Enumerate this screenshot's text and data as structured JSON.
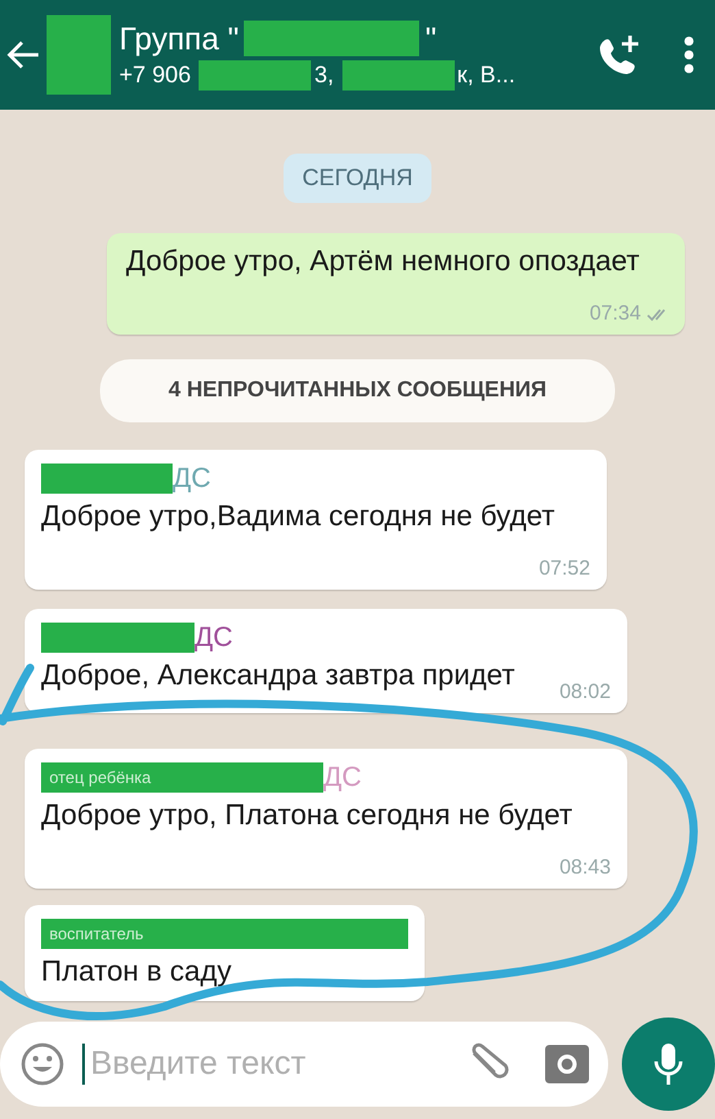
{
  "header": {
    "title": [
      {
        "kind": "text",
        "text": "Группа \""
      },
      {
        "kind": "mask"
      },
      {
        "kind": "text",
        "text": "\""
      }
    ],
    "subtitle": [
      {
        "kind": "text",
        "text": "+7 906"
      },
      {
        "kind": "mask"
      },
      {
        "kind": "text",
        "text": "3,"
      },
      {
        "kind": "mask"
      },
      {
        "kind": "text",
        "text": "к, В..."
      }
    ]
  },
  "messages": [
    {
      "kind": "date",
      "text": "СЕГОДНЯ"
    },
    {
      "kind": "outgoing",
      "text": "Доброе утро, Артём немного опоздает",
      "time": "07:34",
      "read": false
    },
    {
      "kind": "notice",
      "text": "4 НЕПРОЧИТАННЫХ СООБЩЕНИЯ"
    },
    {
      "kind": "incoming",
      "sender": {
        "suffix": "ДС",
        "color": "#6fa9b0"
      },
      "text": "Доброе утро,Вадима сегодня не будет",
      "time": "07:52"
    },
    {
      "kind": "incoming",
      "sender": {
        "suffix": "ДС",
        "color": "#a0509a"
      },
      "text": "Доброе, Александра завтра придет",
      "time": "08:02"
    },
    {
      "kind": "incoming",
      "sender": {
        "mask_text": "отец ребёнка",
        "suffix": "ДС",
        "color": "#d49ac0"
      },
      "text": "Доброе утро, Платона сегодня не будет",
      "time": "08:43"
    },
    {
      "kind": "incoming",
      "sender": {
        "mask_text": "воспитатель"
      },
      "text": "Платон в саду"
    }
  ],
  "composer": {
    "placeholder": "Введите текст"
  }
}
